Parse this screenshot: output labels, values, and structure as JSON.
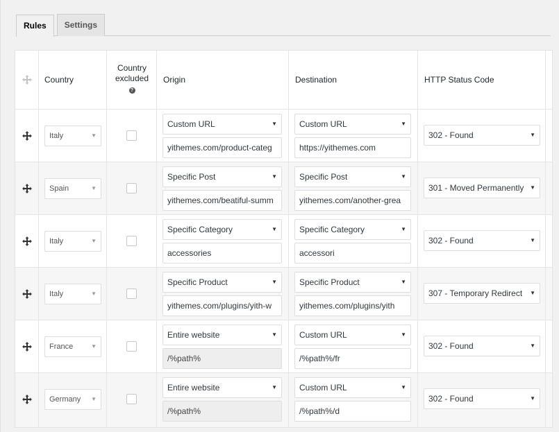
{
  "tabs": [
    {
      "label": "Rules",
      "active": true
    },
    {
      "label": "Settings",
      "active": false
    }
  ],
  "columns": {
    "country": "Country",
    "country_excluded_line1": "Country",
    "country_excluded_line2": "excluded",
    "origin": "Origin",
    "destination": "Destination",
    "http_status": "HTTP Status Code"
  },
  "rows": [
    {
      "country": "Italy",
      "excluded": false,
      "origin_type": "Custom URL",
      "origin_value": "yithemes.com/product-categ",
      "destination_type": "Custom URL",
      "destination_value": "https://yithemes.com",
      "status": "302 - Found"
    },
    {
      "country": "Spain",
      "excluded": false,
      "origin_type": "Specific Post",
      "origin_value": "yithemes.com/beatiful-summ",
      "destination_type": "Specific Post",
      "destination_value": "yithemes.com/another-grea",
      "status": "301 - Moved Permanently"
    },
    {
      "country": "Italy",
      "excluded": false,
      "origin_type": "Specific Category",
      "origin_value": "accessories",
      "destination_type": "Specific Category",
      "destination_value": "accessori",
      "status": "302 - Found"
    },
    {
      "country": "Italy",
      "excluded": false,
      "origin_type": "Specific Product",
      "origin_value": "yithemes.com/plugins/yith-w",
      "destination_type": "Specific Product",
      "destination_value": "yithemes.com/plugins/yith",
      "status": "307 - Temporary Redirect"
    },
    {
      "country": "France",
      "excluded": false,
      "origin_type": "Entire website",
      "origin_value": "/%path%",
      "destination_type": "Custom URL",
      "destination_value": "/%path%/fr",
      "status": "302 - Found"
    },
    {
      "country": "Germany",
      "excluded": false,
      "origin_type": "Entire website",
      "origin_value": "/%path%",
      "destination_type": "Custom URL",
      "destination_value": "/%path%/d",
      "status": "302 - Found"
    }
  ]
}
